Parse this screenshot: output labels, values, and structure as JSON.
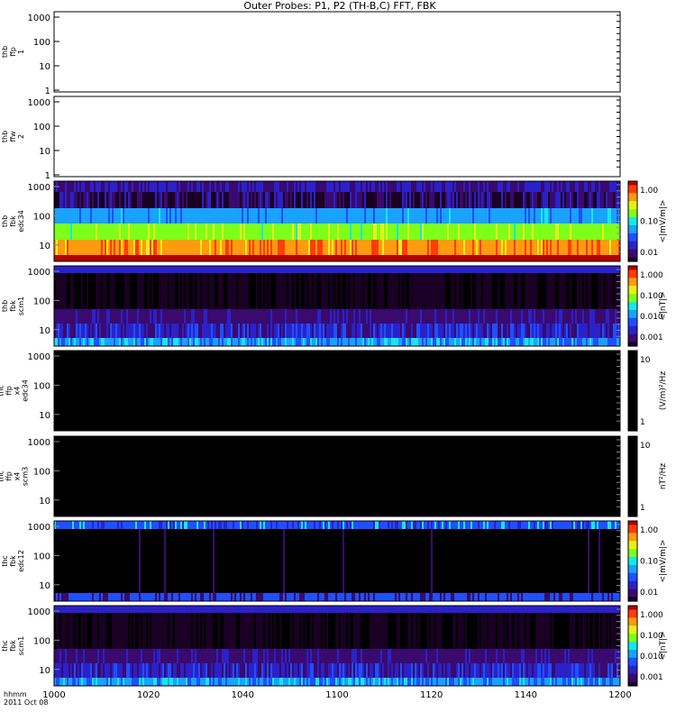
{
  "title": "Outer Probes: P1, P2 (TH-B,C) FFT, FBK",
  "time_axis": {
    "ticks": [
      "1000",
      "1020",
      "1040",
      "1100",
      "1120",
      "1140",
      "1200"
    ],
    "label_line1": "hhmm",
    "label_line2": "2011 Oct 08"
  },
  "colors": {
    "background": "#ffffff",
    "plot_black": "#000000",
    "colormap": [
      "#1a0024",
      "#3a0a6e",
      "#2a22c8",
      "#1f50ff",
      "#19a2ff",
      "#19e6e6",
      "#7dff19",
      "#e6f019",
      "#ff9b0f",
      "#ff3c0a",
      "#b40000"
    ]
  },
  "panels": [
    {
      "id": "p1",
      "ylabel": [
        "thb",
        "ffp",
        "1"
      ],
      "yticks": [
        "1000",
        "100",
        "10",
        "1"
      ],
      "type": "empty",
      "colorbar": null
    },
    {
      "id": "p2",
      "ylabel": [
        "thb",
        "ffw",
        "2"
      ],
      "yticks": [
        "1000",
        "100",
        "10",
        "1"
      ],
      "type": "empty",
      "colorbar": null
    },
    {
      "id": "p3",
      "ylabel": [
        "thb",
        "fbk",
        "edc34"
      ],
      "yticks": [
        "1000",
        "100",
        "10"
      ],
      "type": "spectrogram-bands",
      "colorbar": {
        "ticks": [
          "1.00",
          "0.10",
          "0.01"
        ],
        "unit": "<|mV/m|>"
      }
    },
    {
      "id": "p4",
      "ylabel": [
        "thb",
        "fbk",
        "scm1"
      ],
      "yticks": [
        "1000",
        "100",
        "10"
      ],
      "type": "spectrogram-dark",
      "colorbar": {
        "ticks": [
          "1.000",
          "0.100",
          "0.010",
          "0.001"
        ],
        "unit": "<|nT|>"
      }
    },
    {
      "id": "p5",
      "ylabel": [
        "thc",
        "ffp",
        "x4",
        "edc34"
      ],
      "yticks": [
        "1000",
        "100",
        "10"
      ],
      "type": "black",
      "colorbar": {
        "ticks": [
          "10",
          "1"
        ],
        "unit": "(V/m)²/Hz"
      }
    },
    {
      "id": "p6",
      "ylabel": [
        "thc",
        "ffp",
        "x4",
        "scm3"
      ],
      "yticks": [
        "1000",
        "100",
        "10"
      ],
      "type": "black",
      "colorbar": {
        "ticks": [
          "10",
          "1"
        ],
        "unit": "nT²/Hz"
      }
    },
    {
      "id": "p7",
      "ylabel": [
        "thc",
        "fbk",
        "edc12"
      ],
      "yticks": [
        "1000",
        "100",
        "10"
      ],
      "type": "spectrogram-sparse",
      "colorbar": {
        "ticks": [
          "1.00",
          "0.10",
          "0.01"
        ],
        "unit": "<|mV/m|>"
      }
    },
    {
      "id": "p8",
      "ylabel": [
        "thc",
        "fbk",
        "scm1"
      ],
      "yticks": [
        "1000",
        "100",
        "10"
      ],
      "type": "spectrogram-dark",
      "colorbar": {
        "ticks": [
          "1.000",
          "0.100",
          "0.010",
          "0.001"
        ],
        "unit": "<|nT|>"
      }
    }
  ],
  "chart_data": {
    "type": "heatmap",
    "title": "Outer Probes: P1, P2 (TH-B,C) FFT, FBK",
    "x": [
      "1000",
      "1020",
      "1040",
      "1100",
      "1120",
      "1140",
      "1200"
    ],
    "xlabel": "hhmm / 2011 Oct 08",
    "yscale": "log",
    "series": [
      {
        "name": "thb ffp 1",
        "ylim": [
          1,
          1000
        ],
        "values": "no data"
      },
      {
        "name": "thb ffw 2",
        "ylim": [
          1,
          1000
        ],
        "values": "no data"
      },
      {
        "name": "thb fbk edc34",
        "unit": "<|mV/m|>",
        "zlim": [
          0.01,
          1.0
        ],
        "bands": [
          {
            "freq_range": "~2000-1000",
            "level": "dark purple/black (~0.01)"
          },
          {
            "freq_range": "~200-80",
            "level": "cyan (~0.10)"
          },
          {
            "freq_range": "~80-25",
            "level": "yellow-green (~0.3)"
          },
          {
            "freq_range": "~20-5",
            "level": "orange (~0.8)"
          },
          {
            "freq_range": "<5",
            "level": "dark red (~1.0)"
          }
        ]
      },
      {
        "name": "thb fbk scm1",
        "unit": "<|nT|>",
        "zlim": [
          0.001,
          1.0
        ],
        "bands": [
          {
            "freq_range": "~2000",
            "level": "blue (~0.01)"
          },
          {
            "freq_range": "~1000-60",
            "level": "black/dark (~0.001)"
          },
          {
            "freq_range": "~50-8",
            "level": "purple (~0.003)"
          },
          {
            "freq_range": "<8",
            "level": "blue-cyan (~0.01)"
          }
        ]
      },
      {
        "name": "thc ffp x4 edc34",
        "unit": "(V/m)²/Hz",
        "zlim": [
          1,
          10
        ],
        "values": "all black"
      },
      {
        "name": "thc ffp x4 scm3",
        "unit": "nT²/Hz",
        "zlim": [
          1,
          10
        ],
        "values": "all black"
      },
      {
        "name": "thc fbk edc12",
        "unit": "<|mV/m|>",
        "zlim": [
          0.01,
          1.0
        ],
        "bands": [
          {
            "freq_range": "~2000",
            "level": "blue with cyan streaks"
          },
          {
            "freq_range": "~1000-5",
            "level": "black with sparse purple"
          },
          {
            "freq_range": "<5",
            "level": "blue"
          }
        ]
      },
      {
        "name": "thc fbk scm1",
        "unit": "<|nT|>",
        "zlim": [
          0.001,
          1.0
        ],
        "bands": [
          {
            "freq_range": "~2000",
            "level": "blue"
          },
          {
            "freq_range": "~1000-60",
            "level": "black/dark"
          },
          {
            "freq_range": "~50-5",
            "level": "purple-blue"
          },
          {
            "freq_range": "<5",
            "level": "cyan-blue"
          }
        ]
      }
    ]
  }
}
